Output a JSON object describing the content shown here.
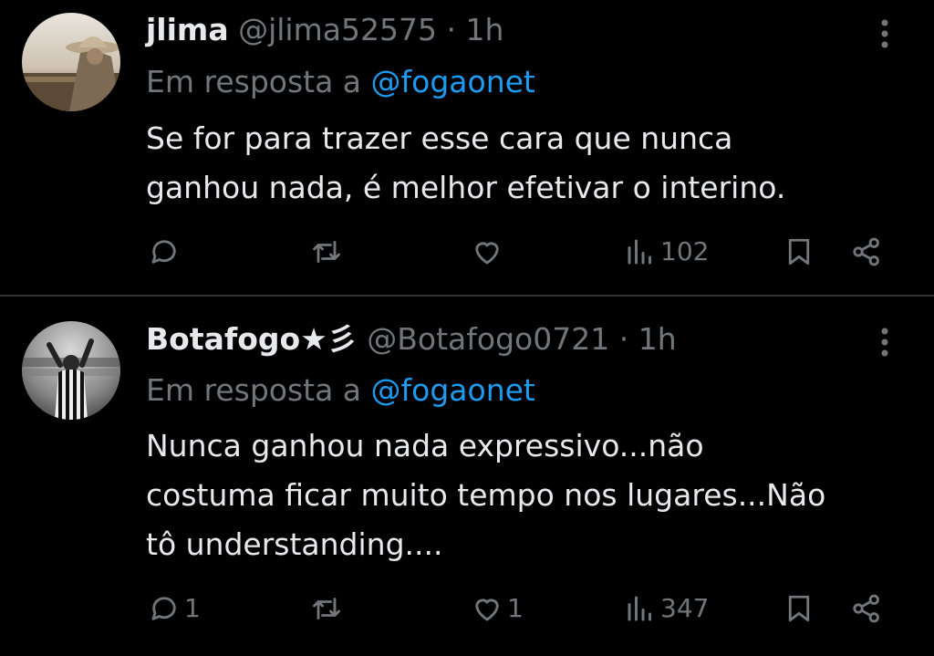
{
  "tweets": [
    {
      "display_name": "jlima",
      "handle": "@jlima52575",
      "separator": "·",
      "time": "1h",
      "reply_prefix": "Em resposta a",
      "reply_to": "@fogaonet",
      "text_lines": [
        "Se for para trazer esse cara que nunca",
        "ganhou nada, é melhor efetivar o interino."
      ],
      "replies": "",
      "retweets": "",
      "likes": "",
      "views": "102"
    },
    {
      "display_name": "Botafogo★彡",
      "handle": "@Botafogo0721",
      "separator": "·",
      "time": "1h",
      "reply_prefix": "Em resposta a",
      "reply_to": "@fogaonet",
      "text_lines": [
        "Nunca ganhou nada expressivo...não",
        "costuma ficar muito tempo nos lugares...Não",
        "tô understanding...."
      ],
      "replies": "1",
      "retweets": "",
      "likes": "1",
      "views": "347"
    }
  ],
  "icons": {
    "reply": "reply-icon",
    "retweet": "retweet-icon",
    "like": "like-icon",
    "views": "views-icon",
    "bookmark": "bookmark-icon",
    "share": "share-icon",
    "more": "more-icon"
  },
  "colors": {
    "background": "#000000",
    "text": "#e7e9ea",
    "muted": "#71767b",
    "link": "#1d9bf0",
    "divider": "#2f3336"
  }
}
